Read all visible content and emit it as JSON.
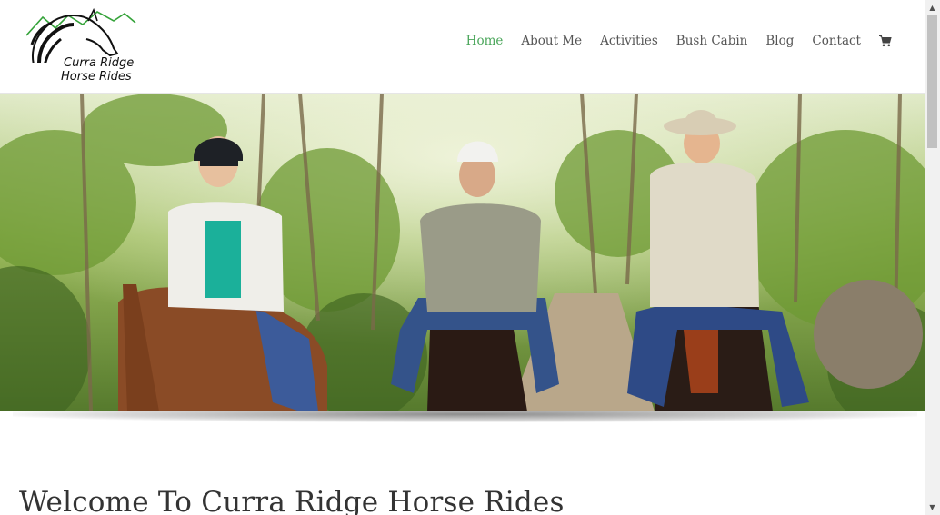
{
  "logo": {
    "line1": "Curra Ridge",
    "line2": "Horse Rides"
  },
  "nav": {
    "items": [
      {
        "label": "Home",
        "active": true
      },
      {
        "label": "About Me",
        "active": false
      },
      {
        "label": "Activities",
        "active": false
      },
      {
        "label": "Bush Cabin",
        "active": false
      },
      {
        "label": "Blog",
        "active": false
      },
      {
        "label": "Contact",
        "active": false
      }
    ],
    "cart_icon": "shopping-cart-icon"
  },
  "colors": {
    "accent": "#4aa65a",
    "text": "#555555",
    "heading": "#333333"
  },
  "main": {
    "heading": "Welcome To Curra Ridge Horse Rides"
  }
}
